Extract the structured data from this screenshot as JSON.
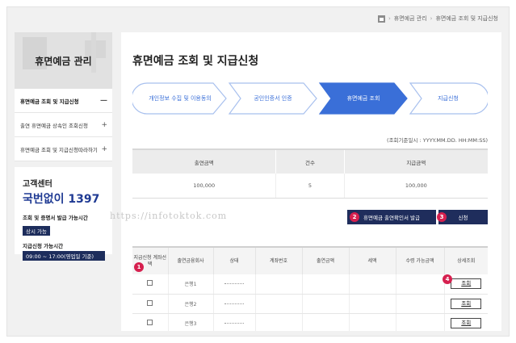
{
  "breadcrumb": {
    "items": [
      "휴면예금 관리",
      "휴면예금 조회 및 지급신청"
    ]
  },
  "sidebar": {
    "title": "휴면예금 관리",
    "items": [
      {
        "label": "휴면예금 조회 및 지급신청",
        "sign": "—"
      },
      {
        "label": "출연 휴면예금 상속인 조회신청",
        "sign": "+"
      },
      {
        "label": "휴면예금 조회 및 지급신청따라하기",
        "sign": "+"
      }
    ]
  },
  "customer_center": {
    "title": "고객센터",
    "number": "국번없이 1397",
    "hours_label": "조회 및 증명서 발급 가능시간",
    "hours_value": "상시 가능",
    "payment_label": "지급신청 가능시간",
    "payment_value": "09:00 ~ 17:00(영업일 기준)"
  },
  "main": {
    "title": "휴면예금 조회 및 지급신청",
    "steps": [
      "개인정보 수집 및 이용동의",
      "공인인증서 인증",
      "휴면예금 조회",
      "지급신청"
    ],
    "active_step": 2,
    "timestamp": "(조회기준일시 : YYYY.MM.DD. HH:MM:SS)"
  },
  "summary": {
    "headers": [
      "출연금액",
      "건수",
      "지급금액"
    ],
    "values": [
      "100,000",
      "5",
      "100,000"
    ]
  },
  "buttons": {
    "cert": "휴면예금 출연확인서 발급",
    "apply": "신청",
    "view": "조회"
  },
  "badges": [
    "1",
    "2",
    "3",
    "4"
  ],
  "watermark": "https://infotoktok.com",
  "detail": {
    "headers": [
      "지급신청 계좌선택",
      "출연금융회사",
      "상태",
      "계좌번호",
      "출연금액",
      "세액",
      "수령 가능금액",
      "상세조회"
    ],
    "rows": [
      {
        "bank": "은행1"
      },
      {
        "bank": "은행2"
      },
      {
        "bank": "은행3"
      }
    ]
  },
  "colors": {
    "navy": "#1f2d5c",
    "accent": "#3a6fd8",
    "badge": "#d6204f"
  }
}
